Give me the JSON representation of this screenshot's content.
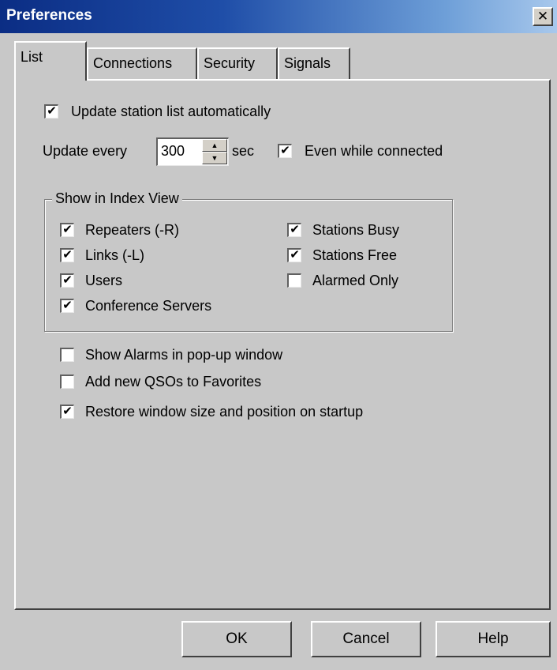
{
  "window": {
    "title": "Preferences",
    "close_glyph": "✕"
  },
  "tabs": [
    {
      "label": "List",
      "active": true
    },
    {
      "label": "Connections",
      "active": false
    },
    {
      "label": "Security",
      "active": false
    },
    {
      "label": "Signals",
      "active": false
    }
  ],
  "update": {
    "auto_label": "Update station list automatically",
    "auto_checked": true,
    "every_label": "Update every",
    "interval_value": "300",
    "unit_label": "sec",
    "while_connected_label": "Even while connected",
    "while_connected_checked": true
  },
  "index_view": {
    "group_label": "Show in Index View",
    "left": [
      {
        "label": "Repeaters (-R)",
        "checked": true
      },
      {
        "label": "Links (-L)",
        "checked": true
      },
      {
        "label": "Users",
        "checked": true
      },
      {
        "label": "Conference Servers",
        "checked": true
      }
    ],
    "right": [
      {
        "label": "Stations Busy",
        "checked": true
      },
      {
        "label": "Stations Free",
        "checked": true
      },
      {
        "label": "Alarmed Only",
        "checked": false
      }
    ]
  },
  "options": [
    {
      "label": "Show Alarms in pop-up window",
      "checked": false
    },
    {
      "label": "Add new QSOs to Favorites",
      "checked": false
    },
    {
      "label": "Restore window size and position on startup",
      "checked": true
    }
  ],
  "buttons": {
    "ok": "OK",
    "cancel": "Cancel",
    "help": "Help"
  },
  "icons": {
    "check": "✔",
    "spin_up": "▲",
    "spin_down": "▼"
  }
}
